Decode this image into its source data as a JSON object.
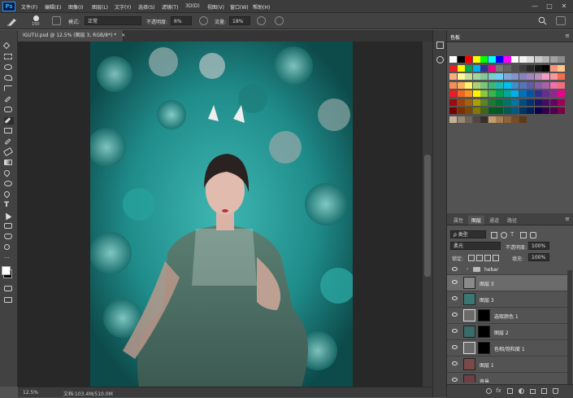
{
  "app": {
    "logo": "Ps"
  },
  "menu": [
    "文件(F)",
    "编辑(E)",
    "图像(I)",
    "图层(L)",
    "文字(Y)",
    "选择(S)",
    "滤镜(T)",
    "3D(D)",
    "视图(V)",
    "窗口(W)",
    "帮助(H)"
  ],
  "window_controls": [
    "—",
    "□",
    "✕"
  ],
  "options": {
    "brush_size": "150",
    "mode_label": "模式:",
    "mode_value": "正常",
    "opacity_label": "不透明度:",
    "opacity_value": "6%",
    "flow_label": "流量:",
    "flow_value": "18%"
  },
  "document": {
    "tab_title": "IGUTU.psd @ 12.5% (图层 3, RGB/8*) *",
    "close": "×"
  },
  "status": {
    "zoom": "12.5%",
    "doc_size": "文档:103.4M/510.0M"
  },
  "swatches": {
    "tab": "色板",
    "colors": [
      [
        "#ffffff",
        "#000000",
        "#ff0000",
        "#ffff00",
        "#00ff00",
        "#00ffff",
        "#0000ff",
        "#ff00ff",
        "#ffffff",
        "#f2f2f2",
        "#dcdcdc",
        "#c8c8c8",
        "#b4b4b4",
        "#a0a0a0",
        "#8c8c8c"
      ],
      [
        "#ed1c24",
        "#fff200",
        "#00a651",
        "#00aeef",
        "#2e3192",
        "#ec008c",
        "#787878",
        "#646464",
        "#505050",
        "#3c3c3c",
        "#282828",
        "#141414",
        "#000000",
        "#f7977a",
        "#fdc68a"
      ],
      [
        "#f9ad81",
        "#fff799",
        "#c4df9b",
        "#a2d39c",
        "#82ca9d",
        "#7bcdc8",
        "#6ecff6",
        "#7ea7d8",
        "#8493ca",
        "#8882be",
        "#a187be",
        "#bc8dbf",
        "#f49ac2",
        "#f6989d",
        "#f26c4f"
      ],
      [
        "#f68e55",
        "#fbaf5c",
        "#fff467",
        "#acd372",
        "#7cc576",
        "#3bb878",
        "#1abbb4",
        "#00bff3",
        "#438ccb",
        "#5574b9",
        "#605ca8",
        "#855fa8",
        "#a763a8",
        "#f06eaa",
        "#f26d7d"
      ],
      [
        "#ed1c24",
        "#f26522",
        "#f7941d",
        "#fff200",
        "#8dc63f",
        "#39b54a",
        "#00a651",
        "#00a99d",
        "#00aeef",
        "#0072bc",
        "#0054a6",
        "#2e3192",
        "#662d91",
        "#92278f",
        "#ec008c"
      ],
      [
        "#9e0b0f",
        "#a0410d",
        "#a3620a",
        "#aba000",
        "#598527",
        "#197b30",
        "#007236",
        "#00746b",
        "#0076a3",
        "#004b80",
        "#003471",
        "#1b1464",
        "#440e62",
        "#630460",
        "#9e005d"
      ],
      [
        "#790000",
        "#7b2e00",
        "#7d4900",
        "#827b00",
        "#406618",
        "#005e20",
        "#005826",
        "#005952",
        "#005b7f",
        "#003663",
        "#002157",
        "#0d004c",
        "#32004b",
        "#4b0049",
        "#7b0046"
      ],
      [
        "#c7b299",
        "#998675",
        "#736357",
        "#534741",
        "#37302a",
        "#c69c6d",
        "#a67c52",
        "#8c6239",
        "#754c24",
        "#603913"
      ]
    ]
  },
  "layers": {
    "tabs": [
      "属性",
      "图层",
      "通道",
      "路径"
    ],
    "active_tab": "图层",
    "filter_kind": "ρ 类型",
    "blend_mode": "柔光",
    "opacity_label": "不透明度:",
    "opacity_value": "100%",
    "lock_label": "锁定:",
    "fill_label": "填充:",
    "fill_value": "100%",
    "rows": [
      {
        "name": "hebar",
        "type": "group",
        "selected": false
      },
      {
        "name": "图层 3",
        "type": "pixel",
        "selected": true
      },
      {
        "name": "图层 3",
        "type": "pixel",
        "selected": false
      },
      {
        "name": "选取颜色 1",
        "type": "adjust",
        "selected": false
      },
      {
        "name": "图层 2",
        "type": "pixel-mask",
        "selected": false
      },
      {
        "name": "色相/饱和度 1",
        "type": "adjust",
        "selected": false
      },
      {
        "name": "图层 1",
        "type": "pixel",
        "selected": false
      },
      {
        "name": "背景",
        "type": "bg",
        "selected": false
      }
    ],
    "footer_icons": [
      "link-icon",
      "fx-icon",
      "mask-icon",
      "adjustment-icon",
      "folder-icon",
      "new-layer-icon",
      "trash-icon"
    ],
    "footer_fx": "fx"
  },
  "colors": {
    "teal": "#1f8c8a",
    "selected_row": "#6b6b6b",
    "panel_bg": "#535353"
  }
}
